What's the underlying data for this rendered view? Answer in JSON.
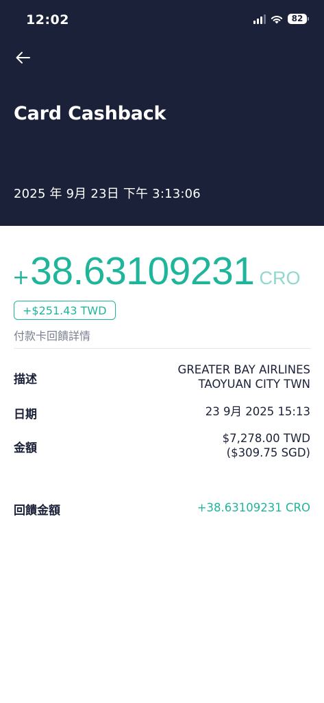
{
  "status_bar": {
    "time": "12:02",
    "battery": "82",
    "icons": [
      "signal-icon",
      "wifi-icon",
      "battery-icon"
    ]
  },
  "header": {
    "back_icon": "arrow-left-icon",
    "title": "Card Cashback",
    "datetime": "2025 年 9月 23日 下午 3:13:06"
  },
  "amount": {
    "sign": "+",
    "value": "38.63109231",
    "unit": "CRO",
    "fiat": "+$251.43 TWD",
    "subtitle": "付款卡回饋詳情"
  },
  "details": {
    "description_label": "描述",
    "description_line1": "GREATER BAY AIRLINES",
    "description_line2": "TAOYUAN CITY TWN",
    "date_label": "日期",
    "date_value": "23 9月 2025 15:13",
    "amount_label": "金額",
    "amount_line1": "$7,278.00 TWD",
    "amount_line2": "($309.75 SGD)",
    "reward_label": "回饋金額",
    "reward_value": "+38.63109231 CRO"
  },
  "colors": {
    "header_bg": "#1a2138",
    "accent": "#1fb59b",
    "accent_light": "#8fd8cb"
  }
}
